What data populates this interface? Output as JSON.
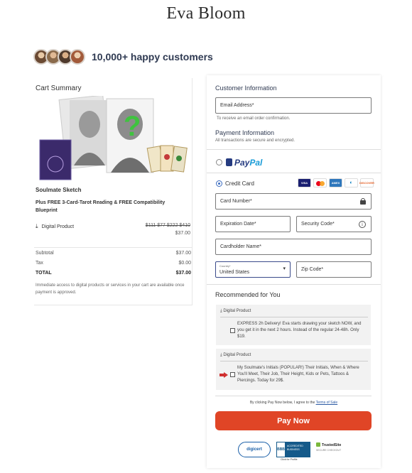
{
  "brand": "Eva Bloom",
  "social_proof": {
    "text": "10,000+ happy customers"
  },
  "cart": {
    "title": "Cart Summary",
    "product_name": "Soulmate Sketch",
    "product_desc": "Plus FREE 3-Card-Tarot Reading & FREE Compatibility Blueprint",
    "product_type": "Digital Product",
    "old_prices": "$111 $77 $222 $410",
    "price": "$37.00",
    "subtotal_label": "Subtotal",
    "subtotal": "$37.00",
    "tax_label": "Tax",
    "tax": "$0.00",
    "total_label": "TOTAL",
    "total": "$37.00",
    "note": "Immediate access to digital products or services in your cart are available once payment is approved."
  },
  "customer": {
    "title": "Customer Information",
    "email_label": "Email Address*",
    "email_hint": "To receive an email order confirmation."
  },
  "payment": {
    "title": "Payment Information",
    "subtitle": "All transactions are secure and encrypted.",
    "paypal_pay": "Pay",
    "paypal_pal": "Pal",
    "credit_card_label": "Credit Card",
    "card_brands": [
      "VISA",
      "MC",
      "AMEX",
      "DC",
      "DISCOVER"
    ],
    "card_number_label": "Card Number*",
    "expiration_label": "Expiration Date*",
    "security_label": "Security Code*",
    "cardholder_label": "Cardholder Name*",
    "country_caption": "Country*",
    "country_value": "United States",
    "zip_label": "Zip Code*"
  },
  "recommended": {
    "title": "Recommended for You",
    "items": [
      {
        "type": "Digital Product",
        "text": "EXPRESS 2h Delivery! Eva starts drawing your sketch NOW, and you get it in the next 2 hours. Instead of the regular 24-48h. Only $19."
      },
      {
        "type": "Digital Product",
        "text": "My Soulmate's Initials (POPULAR!) Their Initials, When & Where You'll Meet, Their Job, Their Height, Kids or Pets, Tattoos & Piercings. Today for 29$."
      }
    ]
  },
  "agree": {
    "prefix": "By clicking Pay Now below, I agree to the",
    "link": "Terms of Sale"
  },
  "pay_button": "Pay Now",
  "badges": {
    "digicert": "digicert",
    "bbb_logo": "BBB",
    "bbb_line1": "ACCREDITED",
    "bbb_line2": "BUSINESS",
    "bbb_caption": "Click for Profile",
    "trusted": "TrustedSite",
    "trusted_sub": "SECURE CHECKOUT"
  },
  "colors": {
    "accent": "#e04526",
    "link": "#2b59a3",
    "paypal_dark": "#253b80",
    "paypal_light": "#179bd7"
  }
}
